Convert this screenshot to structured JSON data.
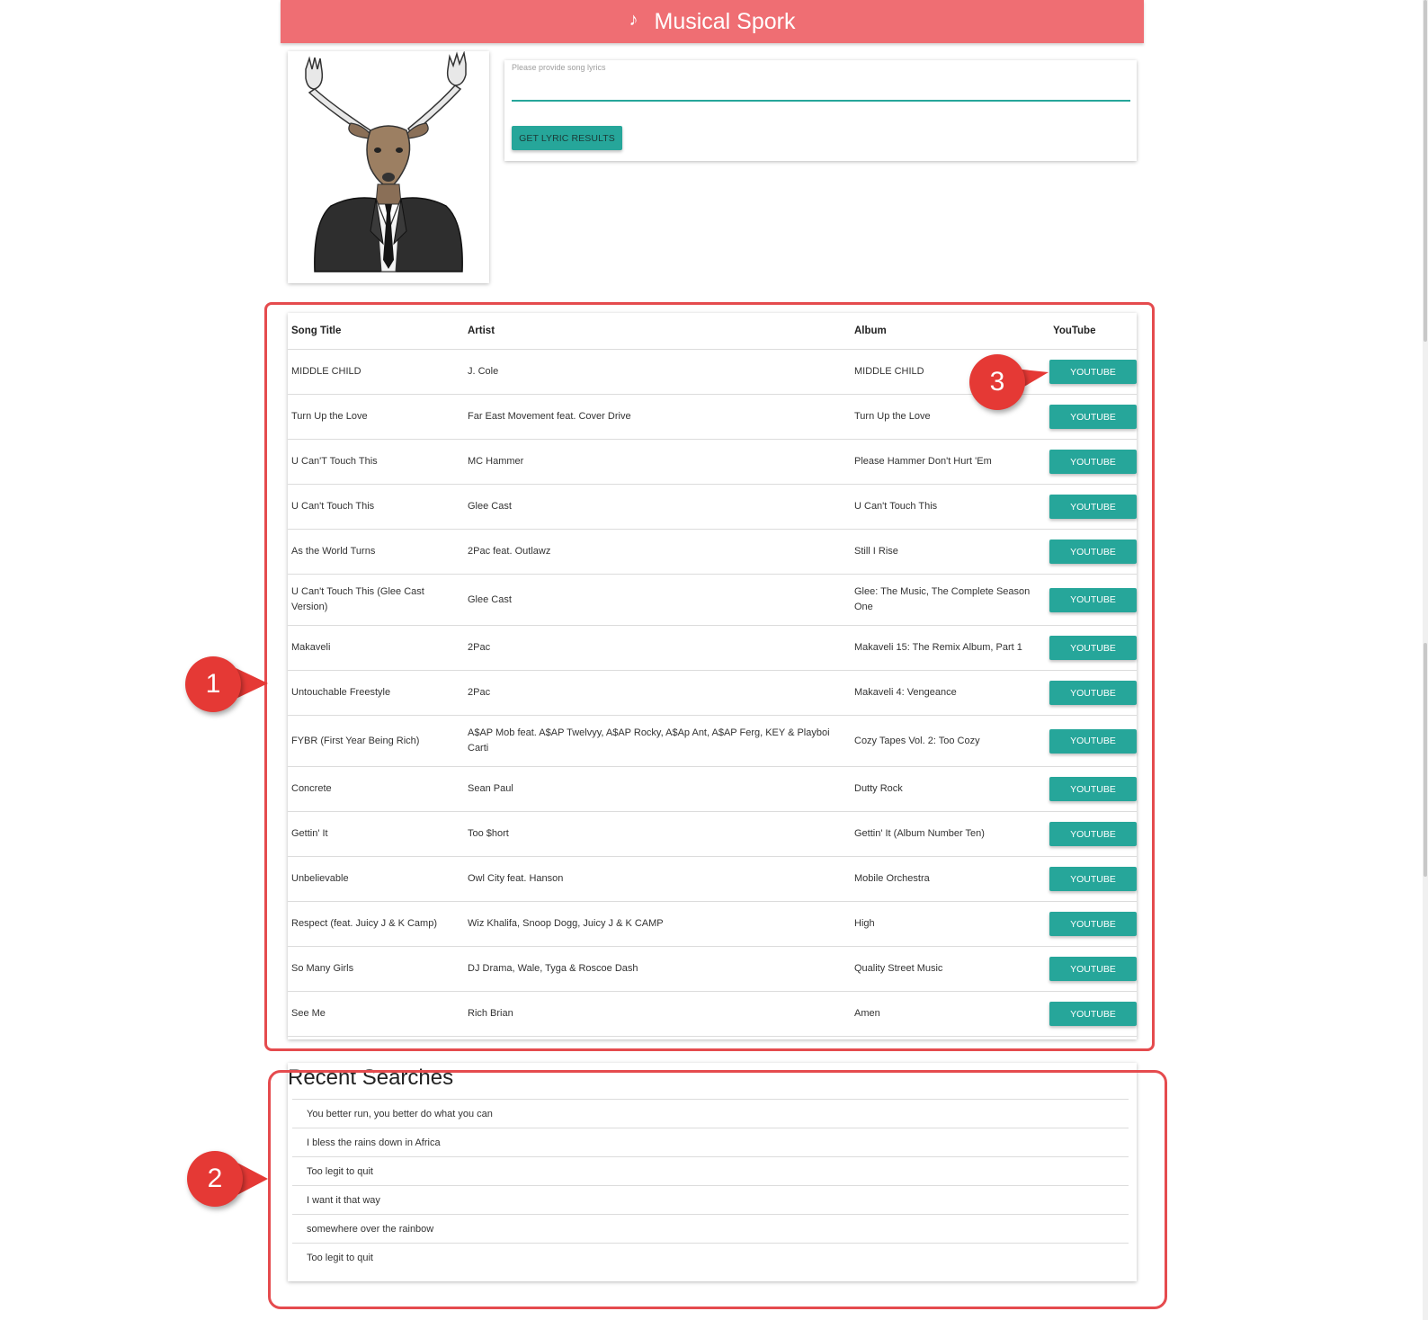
{
  "header": {
    "title": "Musical Spork",
    "icon": "music-note-icon",
    "bg_color": "#ef6e73"
  },
  "search": {
    "label": "Please provide song lyrics",
    "value": "",
    "button_label": "GET LYRIC RESULTS"
  },
  "results": {
    "headers": [
      "Song Title",
      "Artist",
      "Album",
      "YouTube"
    ],
    "button_label": "YOUTUBE",
    "rows": [
      {
        "title": "MIDDLE CHILD",
        "artist": "J. Cole",
        "album": "MIDDLE CHILD"
      },
      {
        "title": "Turn Up the Love",
        "artist": "Far East Movement feat. Cover Drive",
        "album": "Turn Up the Love"
      },
      {
        "title": "U Can'T Touch This",
        "artist": "MC Hammer",
        "album": "Please Hammer Don't Hurt 'Em"
      },
      {
        "title": "U Can't Touch This",
        "artist": "Glee Cast",
        "album": "U Can't Touch This"
      },
      {
        "title": "As the World Turns",
        "artist": "2Pac feat. Outlawz",
        "album": "Still I Rise"
      },
      {
        "title": "U Can't Touch This (Glee Cast Version)",
        "artist": "Glee Cast",
        "album": "Glee: The Music, The Complete Season One"
      },
      {
        "title": "Makaveli",
        "artist": "2Pac",
        "album": "Makaveli 15: The Remix Album, Part 1"
      },
      {
        "title": "Untouchable Freestyle",
        "artist": "2Pac",
        "album": "Makaveli 4: Vengeance"
      },
      {
        "title": "FYBR (First Year Being Rich)",
        "artist": "A$AP Mob feat. A$AP Twelvyy, A$AP Rocky, A$Ap Ant, A$AP Ferg, KEY & Playboi Carti",
        "album": "Cozy Tapes Vol. 2: Too Cozy"
      },
      {
        "title": "Concrete",
        "artist": "Sean Paul",
        "album": "Dutty Rock"
      },
      {
        "title": "Gettin' It",
        "artist": "Too $hort",
        "album": "Gettin' It (Album Number Ten)"
      },
      {
        "title": "Unbelievable",
        "artist": "Owl City feat. Hanson",
        "album": "Mobile Orchestra"
      },
      {
        "title": "Respect (feat. Juicy J & K Camp)",
        "artist": "Wiz Khalifa, Snoop Dogg, Juicy J & K CAMP",
        "album": "High"
      },
      {
        "title": "So Many Girls",
        "artist": "DJ Drama, Wale, Tyga & Roscoe Dash",
        "album": "Quality Street Music"
      },
      {
        "title": "See Me",
        "artist": "Rich Brian",
        "album": "Amen"
      }
    ]
  },
  "recent": {
    "title": "Recent Searches",
    "items": [
      "You better run, you better do what you can",
      "I bless the rains down in Africa",
      "Too legit to quit",
      "I want it that way",
      "somewhere over the rainbow",
      "Too legit to quit"
    ]
  },
  "annotations": {
    "badge_1": "1",
    "badge_2": "2",
    "badge_3": "3",
    "color": "#e53935"
  }
}
